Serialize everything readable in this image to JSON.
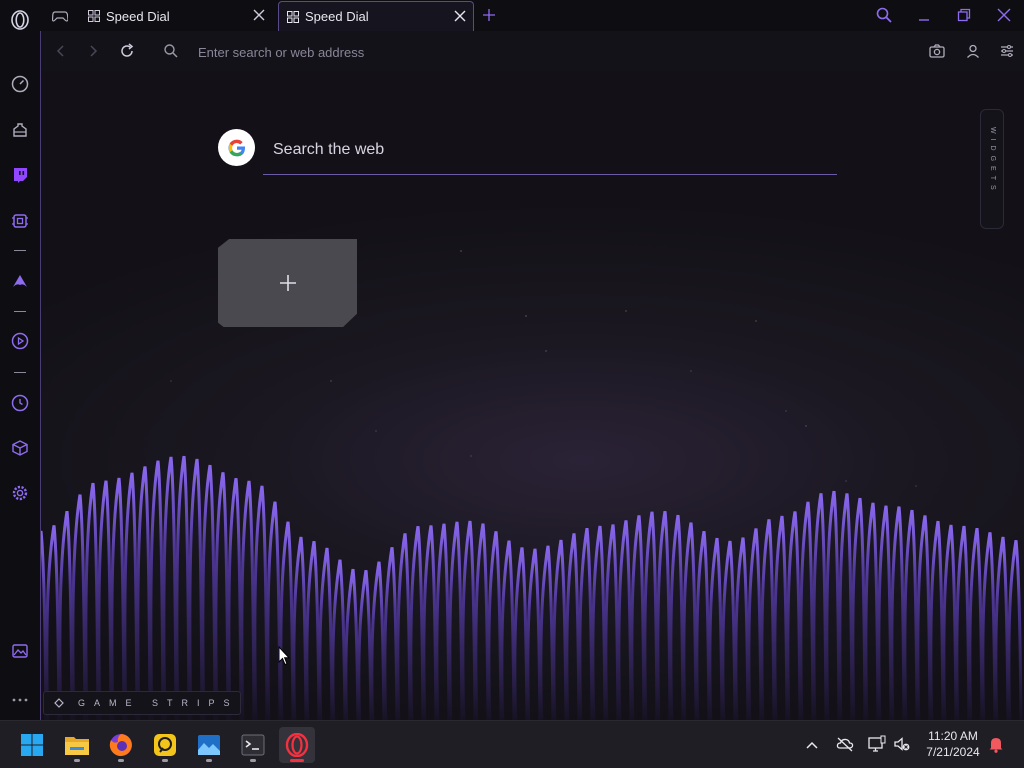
{
  "browser": {
    "name": "Opera GX",
    "accent": "#7b5cd6"
  },
  "tabs": [
    {
      "label": "",
      "icon": "gamepad-icon"
    },
    {
      "label": "Speed Dial",
      "icon": "speed-dial-grid-icon"
    },
    {
      "label": "Speed Dial",
      "icon": "speed-dial-grid-icon",
      "active": true
    }
  ],
  "address_bar": {
    "placeholder": "Enter search or web address"
  },
  "search": {
    "placeholder": "Search the web",
    "engine": "google-logo"
  },
  "widgets": {
    "label": "WIDGETS"
  },
  "game_strips": {
    "label": "GAME STRIPS"
  },
  "sidebar": {
    "items": [
      "opera-logo-icon",
      "speed-dial-icon",
      "gx-corner-icon",
      "twitch-icon",
      "gx-control-icon",
      "aria-icon",
      "player-icon",
      "history-icon",
      "extensions-icon",
      "settings-icon",
      "wallpaper-icon",
      "more-icon"
    ]
  },
  "taskbar": {
    "apps": [
      "windows-start-icon",
      "file-explorer-icon",
      "firefox-icon",
      "app-icon",
      "photos-icon",
      "terminal-icon",
      "opera-gx-icon"
    ],
    "time": "11:20 AM",
    "date": "7/21/2024"
  }
}
